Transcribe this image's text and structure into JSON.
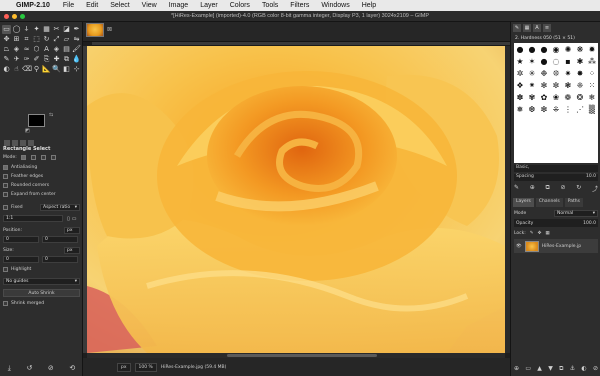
{
  "menubar": {
    "app_name": "GIMP-2.10",
    "items": [
      "File",
      "Edit",
      "Select",
      "View",
      "Image",
      "Layer",
      "Colors",
      "Tools",
      "Filters",
      "Windows",
      "Help"
    ]
  },
  "window": {
    "title": "*[HiRes-Example] (imported)-4.0 (RGB color 8-bit gamma integer, Display P3, 1 layer) 3024x2109 – GIMP"
  },
  "toolbox": {
    "tool_icons": [
      "rect-select",
      "ellipse-select",
      "free-select",
      "fuzzy-select",
      "by-color-select",
      "scissors",
      "foreground-select",
      "paths",
      "move",
      "align",
      "crop",
      "unified-transform",
      "rotate",
      "scale",
      "shear",
      "flip",
      "perspective",
      "3d-transform",
      "warp",
      "cage",
      "text",
      "bucket-fill",
      "gradient",
      "paintbrush",
      "pencil",
      "airbrush",
      "ink",
      "mypaint",
      "clone",
      "heal",
      "perspective-clone",
      "blur",
      "dodge",
      "smudge",
      "eraser",
      "color-picker",
      "measure",
      "zoom",
      "mode",
      "handle"
    ],
    "tool_options": {
      "title": "Rectangle Select",
      "mode_label": "Mode:",
      "antialiasing": "Antialiasing",
      "feather_edges": "Feather edges",
      "rounded_corners": "Rounded corners",
      "expand_from_center": "Expand from center",
      "fixed_label": "Fixed",
      "aspect_ratio": "Aspect ratio",
      "ratio_value": "1:1",
      "position_label": "Position:",
      "position_unit": "px",
      "position_x": "0",
      "position_y": "0",
      "size_label": "Size:",
      "size_unit": "px",
      "size_w": "0",
      "size_h": "0",
      "highlight": "Highlight",
      "guides": "No guides",
      "auto_shrink": "Auto Shrink",
      "shrink_merged": "Shrink merged"
    }
  },
  "status": {
    "unit": "px",
    "zoom": "100 %",
    "file_info": "HiRes-Example.jpg (59.4 MB)"
  },
  "dock": {
    "brush_name": "2. Hardness 050 (51 × 51)",
    "brush_tag": "Basic,",
    "spacing_label": "Spacing",
    "spacing_value": "10.0",
    "layer_tabs": [
      "Layers",
      "Channels",
      "Paths"
    ],
    "mode_label": "Mode",
    "mode_value": "Normal",
    "opacity_label": "Opacity",
    "opacity_value": "100.0",
    "lock_label": "Lock:",
    "layer_name": "HiRes-Example.jp"
  }
}
